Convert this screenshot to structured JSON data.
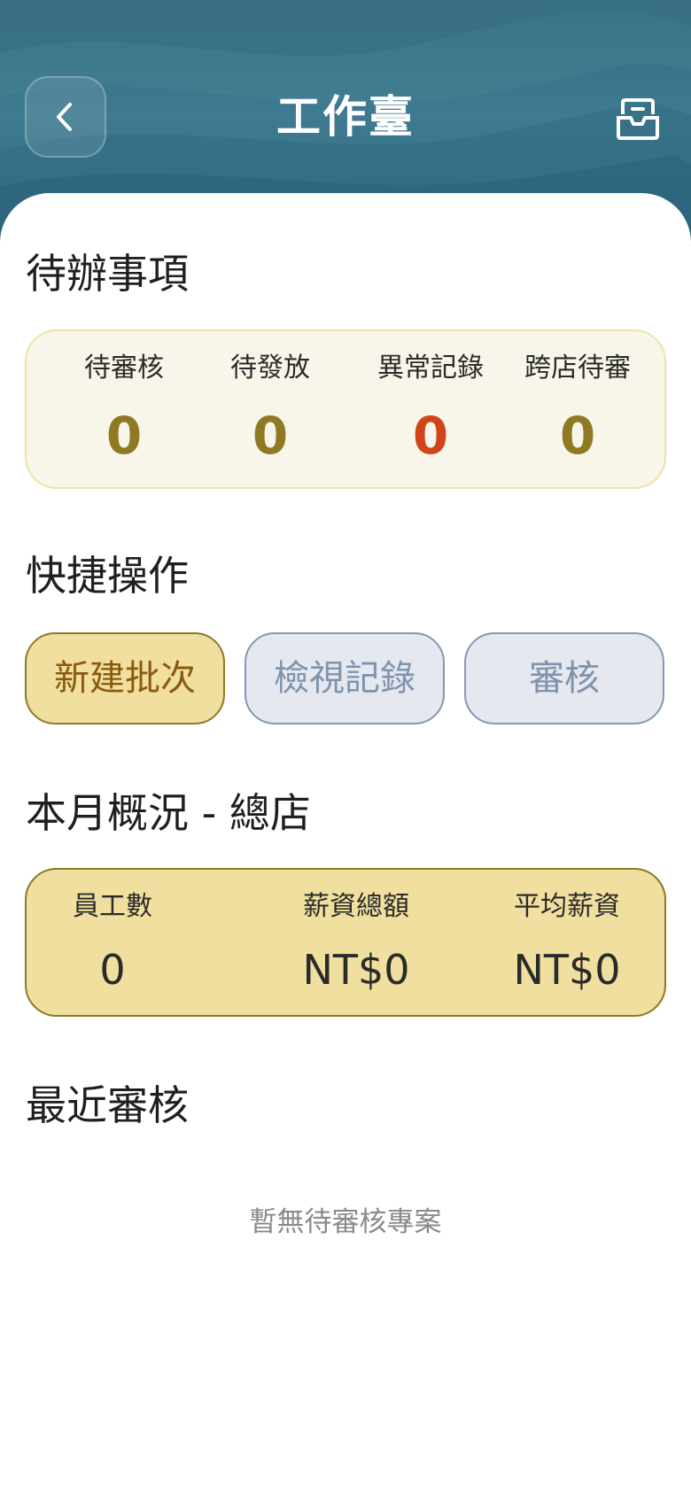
{
  "header": {
    "title": "工作臺",
    "back_icon": "chevron-left-icon",
    "inbox_icon": "inbox-icon"
  },
  "todo": {
    "title": "待辦事項",
    "items": [
      {
        "label": "待審核",
        "value": "0",
        "color": "#8e7a22"
      },
      {
        "label": "待發放",
        "value": "0",
        "color": "#8e7a22"
      },
      {
        "label": "異常記錄",
        "value": "0",
        "color": "#d2451a"
      },
      {
        "label": "跨店待審",
        "value": "0",
        "color": "#8e7a22"
      }
    ]
  },
  "quick_actions": {
    "title": "快捷操作",
    "buttons": [
      {
        "label": "新建批次"
      },
      {
        "label": "檢視記錄"
      },
      {
        "label": "審核"
      }
    ]
  },
  "monthly_summary": {
    "title": "本月概況 - 總店",
    "items": [
      {
        "label": "員工數",
        "value": "0"
      },
      {
        "label": "薪資總額",
        "value": "NT$0"
      },
      {
        "label": "平均薪資",
        "value": "NT$0"
      }
    ]
  },
  "recent_reviews": {
    "title": "最近審核",
    "empty_text": "暫無待審核專案"
  },
  "colors": {
    "header_bg": "#3a7489",
    "accent_gold": "#f0df9e",
    "accent_gold_border": "#8b7a28",
    "alert_red": "#d2451a"
  }
}
